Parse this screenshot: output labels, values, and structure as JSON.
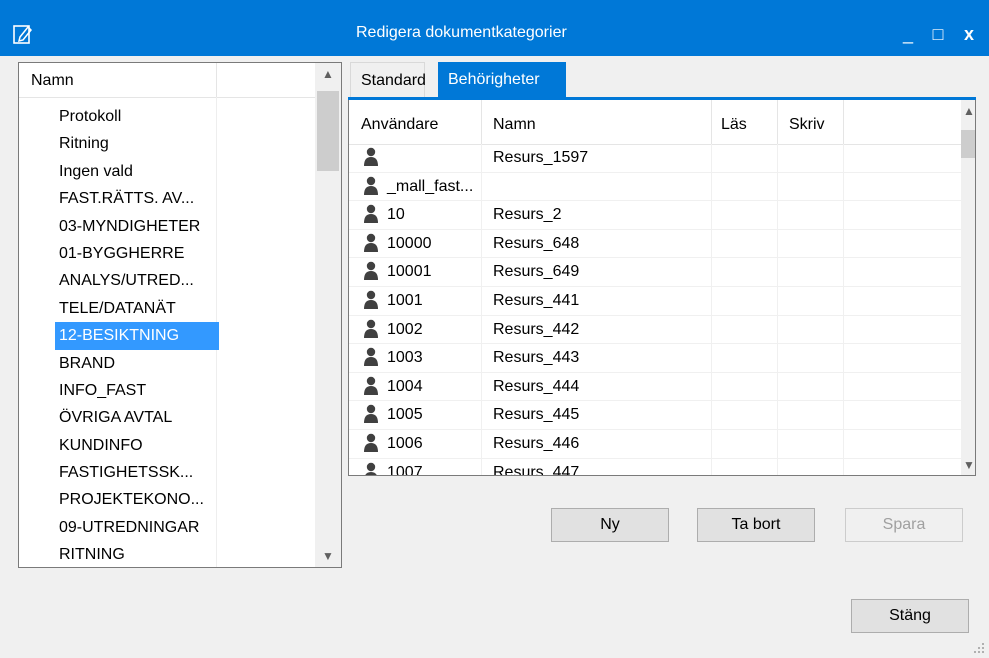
{
  "window": {
    "title": "Redigera dokumentkategorier",
    "minimize_glyph": "_",
    "maximize_glyph": "□",
    "close_glyph": "x"
  },
  "category_list": {
    "column_header": "Namn",
    "items": [
      "Protokoll",
      "Ritning",
      "Ingen vald",
      "FAST.RÄTTS. AV...",
      "03-MYNDIGHETER",
      "01-BYGGHERRE",
      "ANALYS/UTRED...",
      "TELE/DATANÄT",
      "12-BESIKTNING",
      "BRAND",
      "INFO_FAST",
      "ÖVRIGA AVTAL",
      "KUNDINFO",
      "FASTIGHETSSK...",
      "PROJEKTEKONO...",
      "09-UTREDNINGAR",
      "RITNING"
    ],
    "selected_index": 8
  },
  "tabs": [
    {
      "label": "Standard",
      "active": false
    },
    {
      "label": "Behörigheter",
      "active": true
    }
  ],
  "permissions_grid": {
    "headers": {
      "user": "Användare",
      "name": "Namn",
      "read": "Läs",
      "write": "Skriv"
    },
    "rows": [
      {
        "user": "",
        "name": "Resurs_1597"
      },
      {
        "user": "_mall_fast...",
        "name": ""
      },
      {
        "user": "10",
        "name": "Resurs_2"
      },
      {
        "user": "10000",
        "name": "Resurs_648"
      },
      {
        "user": "10001",
        "name": "Resurs_649"
      },
      {
        "user": "1001",
        "name": "Resurs_441"
      },
      {
        "user": "1002",
        "name": "Resurs_442"
      },
      {
        "user": "1003",
        "name": "Resurs_443"
      },
      {
        "user": "1004",
        "name": "Resurs_444"
      },
      {
        "user": "1005",
        "name": "Resurs_445"
      },
      {
        "user": "1006",
        "name": "Resurs_446"
      },
      {
        "user": "1007",
        "name": "Resurs_447"
      }
    ],
    "row_icon": "user-icon"
  },
  "buttons": {
    "new": "Ny",
    "delete": "Ta bort",
    "save": "Spara",
    "close": "Stäng"
  },
  "colors": {
    "accent": "#0078d7",
    "selection": "#3399ff"
  }
}
